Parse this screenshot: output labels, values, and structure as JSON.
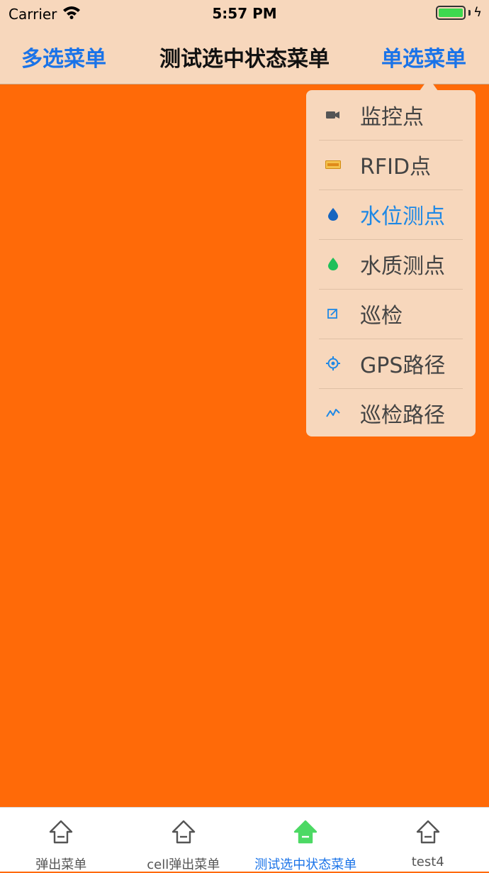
{
  "status_bar": {
    "carrier": "Carrier",
    "time": "5:57 PM"
  },
  "nav": {
    "left_label": "多选菜单",
    "title": "测试选中状态菜单",
    "right_label": "单选菜单"
  },
  "dropdown": {
    "items": [
      {
        "label": "监控点",
        "icon": "video-camera-icon"
      },
      {
        "label": "RFID点",
        "icon": "rfid-tag-icon"
      },
      {
        "label": "水位测点",
        "icon": "water-drop-blue-icon",
        "selected": true
      },
      {
        "label": "水质测点",
        "icon": "water-drop-green-icon"
      },
      {
        "label": "巡检",
        "icon": "edit-square-icon"
      },
      {
        "label": "GPS路径",
        "icon": "gps-crosshair-icon"
      },
      {
        "label": "巡检路径",
        "icon": "route-line-icon"
      }
    ],
    "selected_color": "#1e88e5"
  },
  "tabs": [
    {
      "label": "弹出菜单",
      "icon": "house-icon"
    },
    {
      "label": "cell弹出菜单",
      "icon": "house-icon"
    },
    {
      "label": "测试选中状态菜单",
      "icon": "house-icon",
      "active": true
    },
    {
      "label": "test4",
      "icon": "house-icon"
    }
  ],
  "colors": {
    "background": "#ff6a08",
    "bar": "#f7d7bc",
    "accent": "#1a73e8",
    "active_tab_icon": "#4cd964"
  }
}
